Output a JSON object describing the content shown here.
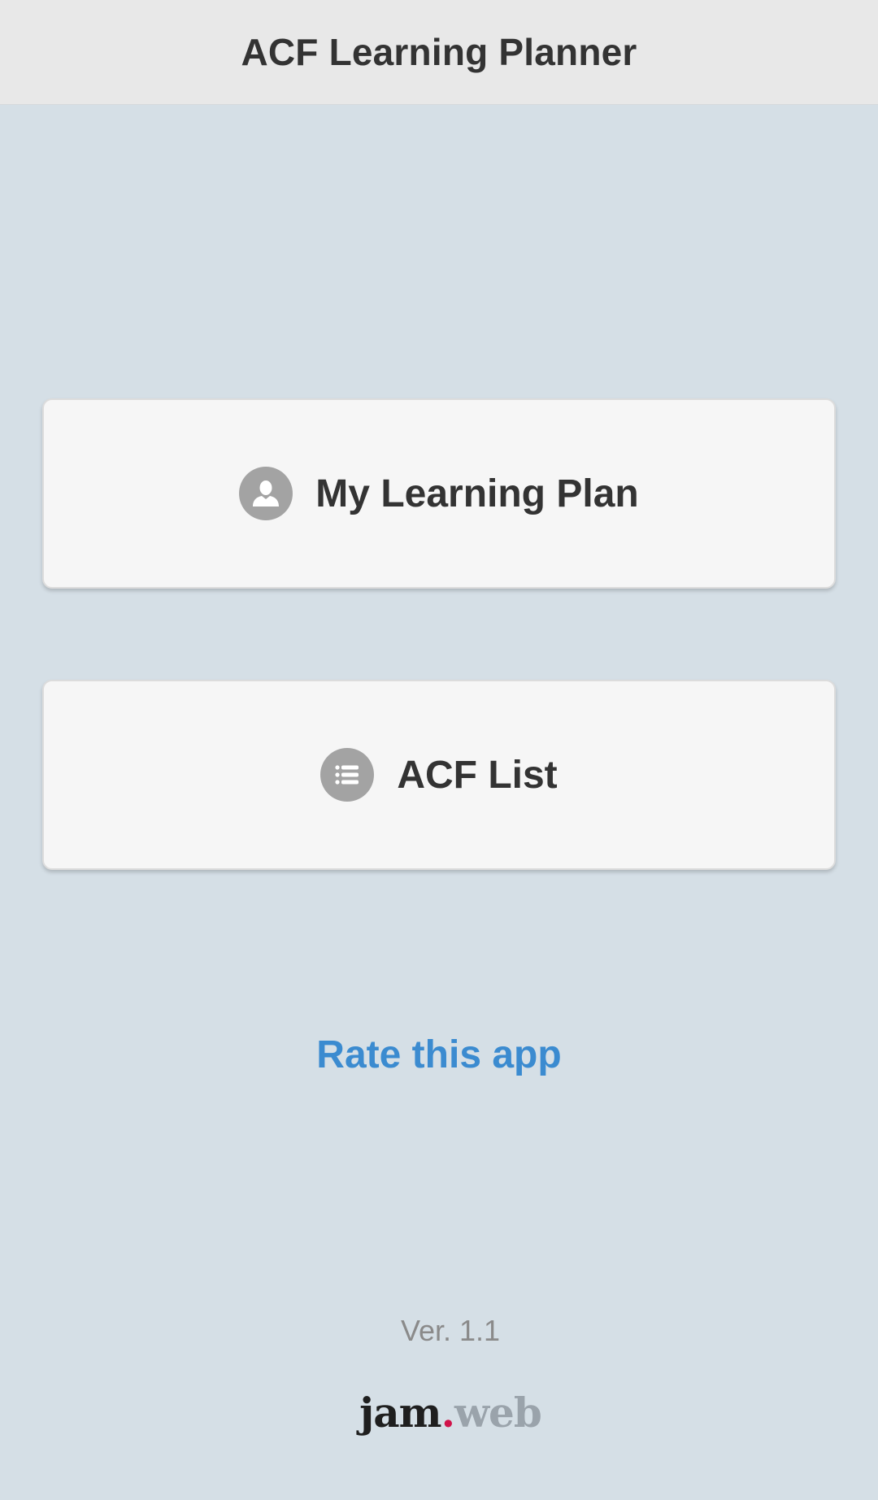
{
  "header": {
    "title": "ACF Learning Planner"
  },
  "buttons": {
    "plan": {
      "label": "My Learning Plan",
      "icon": "person-icon"
    },
    "list": {
      "label": "ACF List",
      "icon": "list-icon"
    }
  },
  "rate": {
    "label": "Rate this app"
  },
  "footer": {
    "version": "Ver. 1.1",
    "logo": {
      "part1": "jam",
      "part2": ".",
      "part3": "web"
    }
  },
  "colors": {
    "accent": "#3b8bd0",
    "background": "#d5dfe6",
    "header": "#e8e8e8",
    "logo_dot": "#d0134a"
  }
}
